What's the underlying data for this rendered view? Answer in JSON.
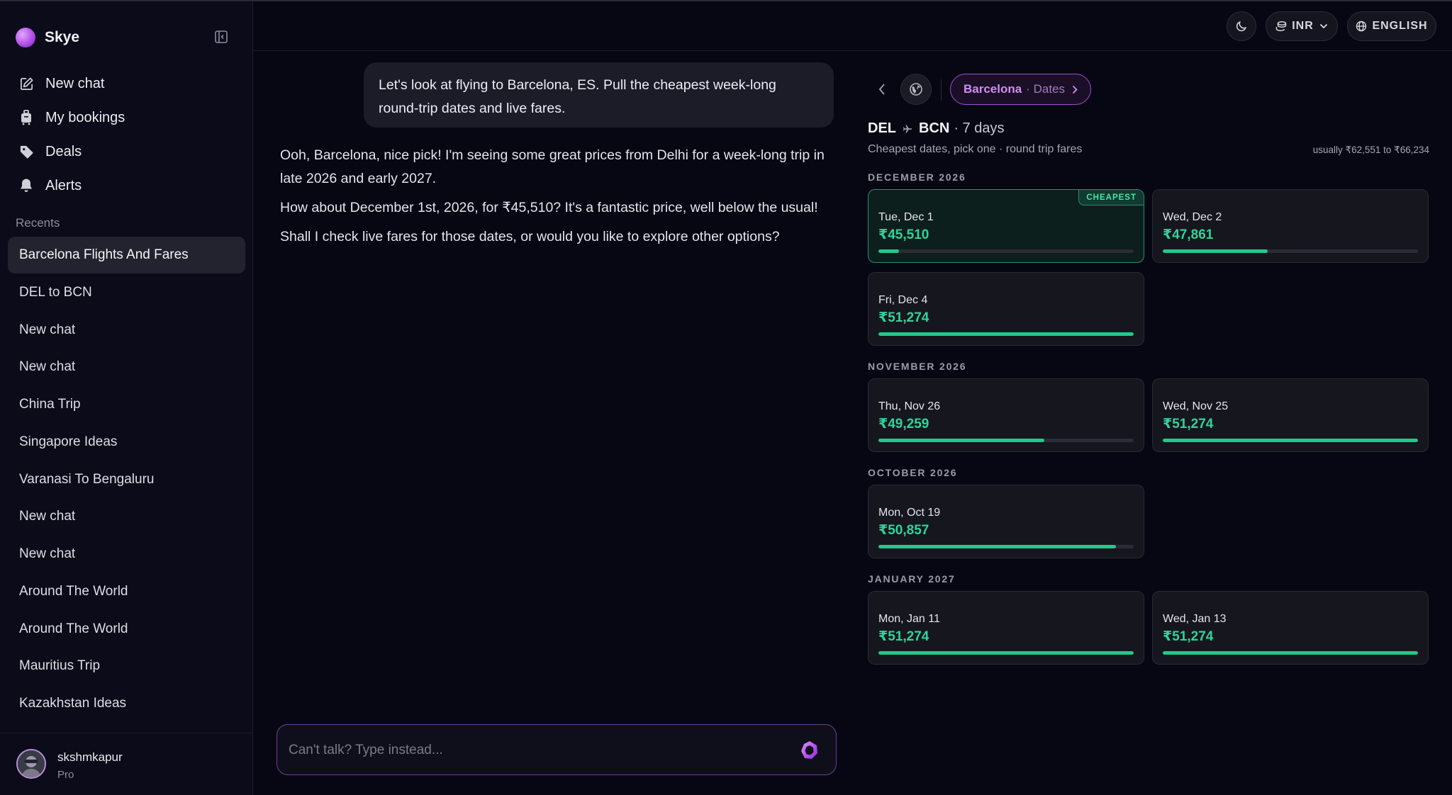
{
  "app": {
    "name": "Skye"
  },
  "nav": [
    {
      "label": "New chat",
      "icon": "edit-icon"
    },
    {
      "label": "My bookings",
      "icon": "luggage-icon"
    },
    {
      "label": "Deals",
      "icon": "tag-icon"
    },
    {
      "label": "Alerts",
      "icon": "bell-icon"
    }
  ],
  "recents": {
    "title": "Recents",
    "items": [
      "Barcelona Flights And Fares",
      "DEL to BCN",
      "New chat",
      "New chat",
      "China Trip",
      "Singapore Ideas",
      "Varanasi To Bengaluru",
      "New chat",
      "New chat",
      "Around The World",
      "Around The World",
      "Mauritius Trip",
      "Kazakhstan Ideas"
    ],
    "active_index": 0
  },
  "user": {
    "name": "skshmkapur",
    "plan": "Pro"
  },
  "topbar": {
    "currency": "INR",
    "language": "ENGLISH"
  },
  "chat": {
    "user_message": "Let's look at flying to Barcelona, ES. Pull the cheapest week-long round-trip dates and live fares.",
    "assistant": [
      "Ooh, Barcelona, nice pick! I'm seeing some great prices from Delhi for a week-long trip in late 2026 and early 2027.",
      "How about December 1st, 2026, for ₹45,510? It's a fantastic price, well below the usual!",
      "Shall I check live fares for those dates, or would you like to explore other options?"
    ],
    "input_placeholder": "Can't talk? Type instead..."
  },
  "panel": {
    "dest_city": "Barcelona",
    "dest_sub": "· Dates",
    "origin": "DEL",
    "destination": "BCN",
    "duration": "· 7 days",
    "subtitle": "Cheapest dates, pick one · round trip fares",
    "usual_range": "usually ₹62,551 to ₹66,234",
    "cheapest_badge": "CHEAPEST",
    "months": [
      {
        "label": "DECEMBER 2026",
        "cards": [
          {
            "date": "Tue, Dec 1",
            "price": "₹45,510",
            "level": 0.08,
            "cheapest": true
          },
          {
            "date": "Wed, Dec 2",
            "price": "₹47,861",
            "level": 0.41
          },
          {
            "date": "Fri, Dec 4",
            "price": "₹51,274",
            "level": 1.0
          }
        ]
      },
      {
        "label": "NOVEMBER 2026",
        "cards": [
          {
            "date": "Thu, Nov 26",
            "price": "₹49,259",
            "level": 0.65
          },
          {
            "date": "Wed, Nov 25",
            "price": "₹51,274",
            "level": 1.0
          }
        ]
      },
      {
        "label": "OCTOBER 2026",
        "cards": [
          {
            "date": "Mon, Oct 19",
            "price": "₹50,857",
            "level": 0.93
          }
        ]
      },
      {
        "label": "JANUARY 2027",
        "cards": [
          {
            "date": "Mon, Jan 11",
            "price": "₹51,274",
            "level": 1.0
          },
          {
            "date": "Wed, Jan 13",
            "price": "₹51,274",
            "level": 1.0
          }
        ]
      }
    ]
  }
}
